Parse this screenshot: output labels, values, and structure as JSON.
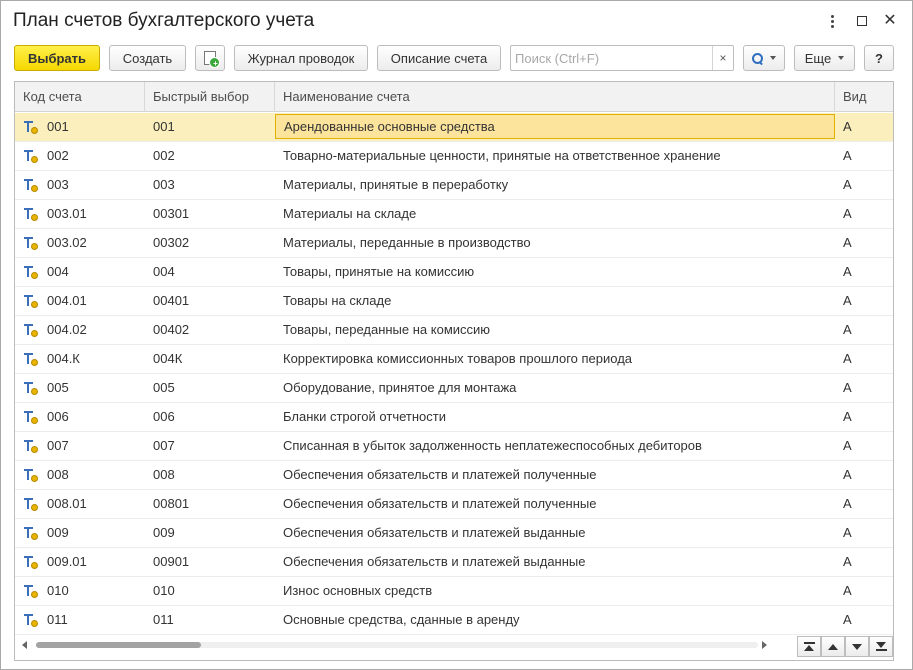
{
  "window": {
    "title": "План счетов бухгалтерского учета"
  },
  "toolbar": {
    "select_label": "Выбрать",
    "create_label": "Создать",
    "journal_label": "Журнал проводок",
    "description_label": "Описание счета",
    "more_label": "Еще",
    "help_label": "?",
    "search": {
      "value": "",
      "placeholder": "Поиск (Ctrl+F)",
      "clear_label": "×"
    }
  },
  "colors": {
    "primary_button": "#f5d800",
    "selected_row": "#fbefbd",
    "selected_cell": "#fce49c",
    "account_icon": "#3b6eb8",
    "account_icon_dot": "#e8b400"
  },
  "table": {
    "columns": [
      "Код счета",
      "Быстрый выбор",
      "Наименование счета",
      "Вид"
    ],
    "selected_index": 0,
    "row_icon": "account-icon",
    "rows": [
      {
        "code": "001",
        "quick": "001",
        "name": "Арендованные основные средства",
        "kind": "А"
      },
      {
        "code": "002",
        "quick": "002",
        "name": "Товарно-материальные ценности, принятые на ответственное хранение",
        "kind": "А"
      },
      {
        "code": "003",
        "quick": "003",
        "name": "Материалы, принятые в переработку",
        "kind": "А"
      },
      {
        "code": "003.01",
        "quick": "00301",
        "name": "Материалы на складе",
        "kind": "А"
      },
      {
        "code": "003.02",
        "quick": "00302",
        "name": "Материалы, переданные в производство",
        "kind": "А"
      },
      {
        "code": "004",
        "quick": "004",
        "name": "Товары, принятые на комиссию",
        "kind": "А"
      },
      {
        "code": "004.01",
        "quick": "00401",
        "name": "Товары на складе",
        "kind": "А"
      },
      {
        "code": "004.02",
        "quick": "00402",
        "name": "Товары, переданные на комиссию",
        "kind": "А"
      },
      {
        "code": "004.К",
        "quick": "004К",
        "name": "Корректировка комиссионных товаров прошлого периода",
        "kind": "А"
      },
      {
        "code": "005",
        "quick": "005",
        "name": "Оборудование, принятое для монтажа",
        "kind": "А"
      },
      {
        "code": "006",
        "quick": "006",
        "name": "Бланки строгой отчетности",
        "kind": "А"
      },
      {
        "code": "007",
        "quick": "007",
        "name": "Списанная в убыток задолженность неплатежеспособных дебиторов",
        "kind": "А"
      },
      {
        "code": "008",
        "quick": "008",
        "name": "Обеспечения обязательств и платежей полученные",
        "kind": "А"
      },
      {
        "code": "008.01",
        "quick": "00801",
        "name": "Обеспечения обязательств и платежей полученные",
        "kind": "А"
      },
      {
        "code": "009",
        "quick": "009",
        "name": "Обеспечения обязательств и платежей выданные",
        "kind": "А"
      },
      {
        "code": "009.01",
        "quick": "00901",
        "name": "Обеспечения обязательств и платежей выданные",
        "kind": "А"
      },
      {
        "code": "010",
        "quick": "010",
        "name": "Износ основных средств",
        "kind": "А"
      },
      {
        "code": "011",
        "quick": "011",
        "name": "Основные средства, сданные в аренду",
        "kind": "А"
      }
    ]
  },
  "scrollbar": {
    "horizontal_position": 0
  }
}
